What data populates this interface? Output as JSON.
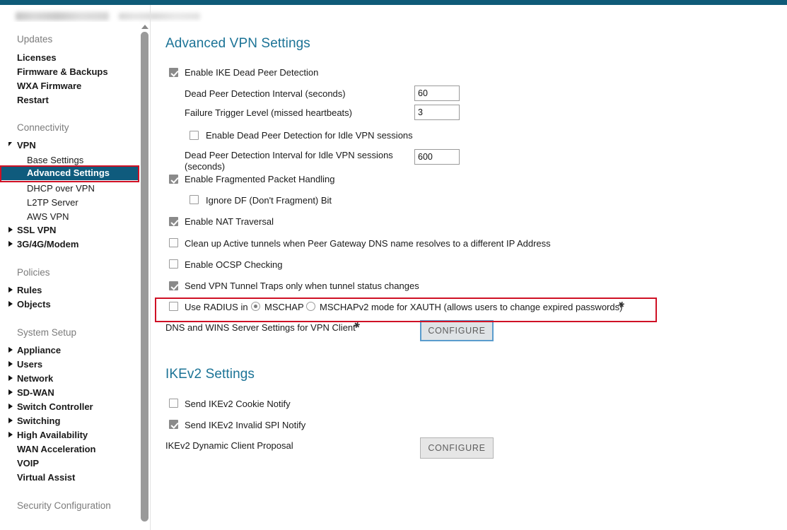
{
  "window": {
    "accent_teal": "#0f5b78",
    "highlight_red": "#cf1125",
    "selected_nav_bg": "#0f5b7d",
    "heading_color": "#1b7396"
  },
  "sidebar": {
    "sections": [
      {
        "label": "Updates",
        "items": [
          {
            "label": "Licenses",
            "bold": true,
            "expandable": false
          },
          {
            "label": "Firmware & Backups",
            "bold": true,
            "expandable": false
          },
          {
            "label": "WXA Firmware",
            "bold": true,
            "expandable": false
          },
          {
            "label": "Restart",
            "bold": true,
            "expandable": false
          }
        ]
      },
      {
        "label": "Connectivity",
        "items": [
          {
            "label": "VPN",
            "bold": true,
            "expandable": true,
            "expanded": true
          },
          {
            "label": "Base Settings",
            "bold": false,
            "expandable": false,
            "child": true
          },
          {
            "label": "Advanced Settings",
            "bold": true,
            "expandable": false,
            "child": true,
            "selected": true
          },
          {
            "label": "DHCP over VPN",
            "bold": false,
            "expandable": false,
            "child": true
          },
          {
            "label": "L2TP Server",
            "bold": false,
            "expandable": false,
            "child": true
          },
          {
            "label": "AWS VPN",
            "bold": false,
            "expandable": false,
            "child": true
          },
          {
            "label": "SSL VPN",
            "bold": true,
            "expandable": true,
            "expanded": false
          },
          {
            "label": "3G/4G/Modem",
            "bold": true,
            "expandable": true,
            "expanded": false
          }
        ]
      },
      {
        "label": "Policies",
        "items": [
          {
            "label": "Rules",
            "bold": true,
            "expandable": true,
            "expanded": false
          },
          {
            "label": "Objects",
            "bold": true,
            "expandable": true,
            "expanded": false
          }
        ]
      },
      {
        "label": "System Setup",
        "items": [
          {
            "label": "Appliance",
            "bold": true,
            "expandable": true,
            "expanded": false
          },
          {
            "label": "Users",
            "bold": true,
            "expandable": true,
            "expanded": false
          },
          {
            "label": "Network",
            "bold": true,
            "expandable": true,
            "expanded": false
          },
          {
            "label": "SD-WAN",
            "bold": true,
            "expandable": true,
            "expanded": false
          },
          {
            "label": "Switch Controller",
            "bold": true,
            "expandable": true,
            "expanded": false
          },
          {
            "label": "Switching",
            "bold": true,
            "expandable": true,
            "expanded": false
          },
          {
            "label": "High Availability",
            "bold": true,
            "expandable": true,
            "expanded": false
          },
          {
            "label": "WAN Acceleration",
            "bold": true,
            "expandable": false
          },
          {
            "label": "VOIP",
            "bold": true,
            "expandable": false
          },
          {
            "label": "Virtual Assist",
            "bold": true,
            "expandable": false
          }
        ]
      },
      {
        "label": "Security Configuration",
        "items": []
      }
    ]
  },
  "main": {
    "advanced_vpn": {
      "title": "Advanced VPN Settings",
      "rows": {
        "enable_ike_dpd": {
          "label": "Enable IKE Dead Peer Detection",
          "checked": true
        },
        "dpd_interval": {
          "label": "Dead Peer Detection Interval (seconds)",
          "value": "60"
        },
        "failure_trigger": {
          "label": "Failure Trigger Level (missed heartbeats)",
          "value": "3"
        },
        "dpd_idle": {
          "label": "Enable Dead Peer Detection for Idle VPN sessions",
          "checked": false
        },
        "dpd_idle_interval": {
          "label": "Dead Peer Detection Interval for Idle VPN sessions (seconds)",
          "value": "600"
        },
        "frag_packet": {
          "label": "Enable Fragmented Packet Handling",
          "checked": true
        },
        "ignore_df": {
          "label": "Ignore DF (Don't Fragment) Bit",
          "checked": false
        },
        "nat_traversal": {
          "label": "Enable NAT Traversal",
          "checked": true
        },
        "cleanup_tunnels": {
          "label": "Clean up Active tunnels when Peer Gateway DNS name resolves to a different IP Address",
          "checked": false
        },
        "ocsp": {
          "label": "Enable OCSP Checking",
          "checked": false
        },
        "tunnel_traps": {
          "label": "Send VPN Tunnel Traps only when tunnel status changes",
          "checked": true
        },
        "use_radius": {
          "prefix": "Use RADIUS in",
          "checked": false,
          "options": [
            {
              "label": "MSCHAP",
              "selected": true
            },
            {
              "label": "MSCHAPv2 mode for XAUTH (allows users to change expired passwords)",
              "selected": false
            }
          ]
        },
        "dns_wins": {
          "label": "DNS and WINS Server Settings for VPN Client",
          "button": "CONFIGURE"
        }
      }
    },
    "ikev2": {
      "title": "IKEv2 Settings",
      "rows": {
        "cookie_notify": {
          "label": "Send IKEv2 Cookie Notify",
          "checked": false
        },
        "invalid_spi": {
          "label": "Send IKEv2 Invalid SPI Notify",
          "checked": true
        },
        "dynamic_proposal": {
          "label": "IKEv2 Dynamic Client Proposal",
          "button": "CONFIGURE"
        }
      }
    }
  }
}
